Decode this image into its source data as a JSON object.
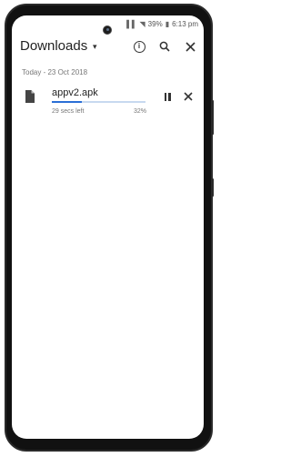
{
  "status_bar": {
    "signal": "ⵎ",
    "battery_pct": "39%",
    "time": "6:13 pm"
  },
  "app_bar": {
    "title": "Downloads",
    "dropdown": "▾"
  },
  "section": {
    "date_header": "Today - 23 Oct 2018"
  },
  "downloads": [
    {
      "file_name": "appv2.apk",
      "status": "29 secs left",
      "progress_label": "32%",
      "progress": 0.32
    }
  ],
  "colors": {
    "accent": "#2b6fd6",
    "track": "#c7d9ef"
  },
  "icons": {
    "info": "info-icon",
    "search": "search-icon",
    "close": "close-icon",
    "pause": "pause-icon",
    "file": "file-icon"
  }
}
